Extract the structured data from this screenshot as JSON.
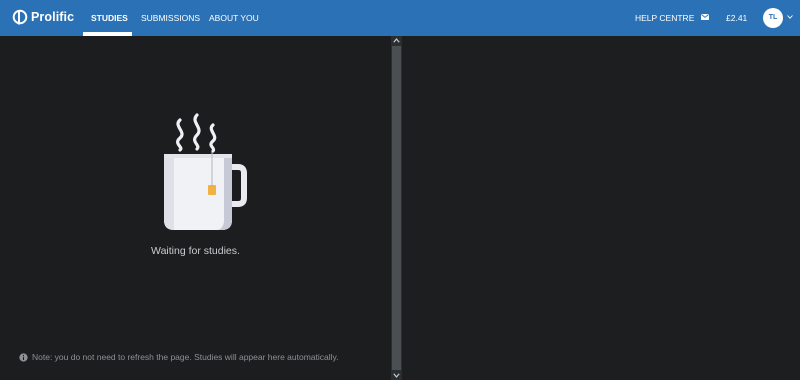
{
  "header": {
    "brand": "Prolific",
    "nav": [
      {
        "label": "STUDIES",
        "active": true
      },
      {
        "label": "SUBMISSIONS",
        "active": false
      },
      {
        "label": "ABOUT YOU",
        "active": false
      }
    ],
    "help_centre": "HELP CENTRE",
    "balance": "£2.41",
    "avatar_initials": "TL",
    "colors": {
      "bar": "#2a72b5",
      "page": "#1b1d1e"
    }
  },
  "main": {
    "empty_state": {
      "illustration": "tea-mug-icon",
      "message": "Waiting for studies."
    },
    "note": "Note: you do not need to refresh the page. Studies will appear here automatically."
  }
}
